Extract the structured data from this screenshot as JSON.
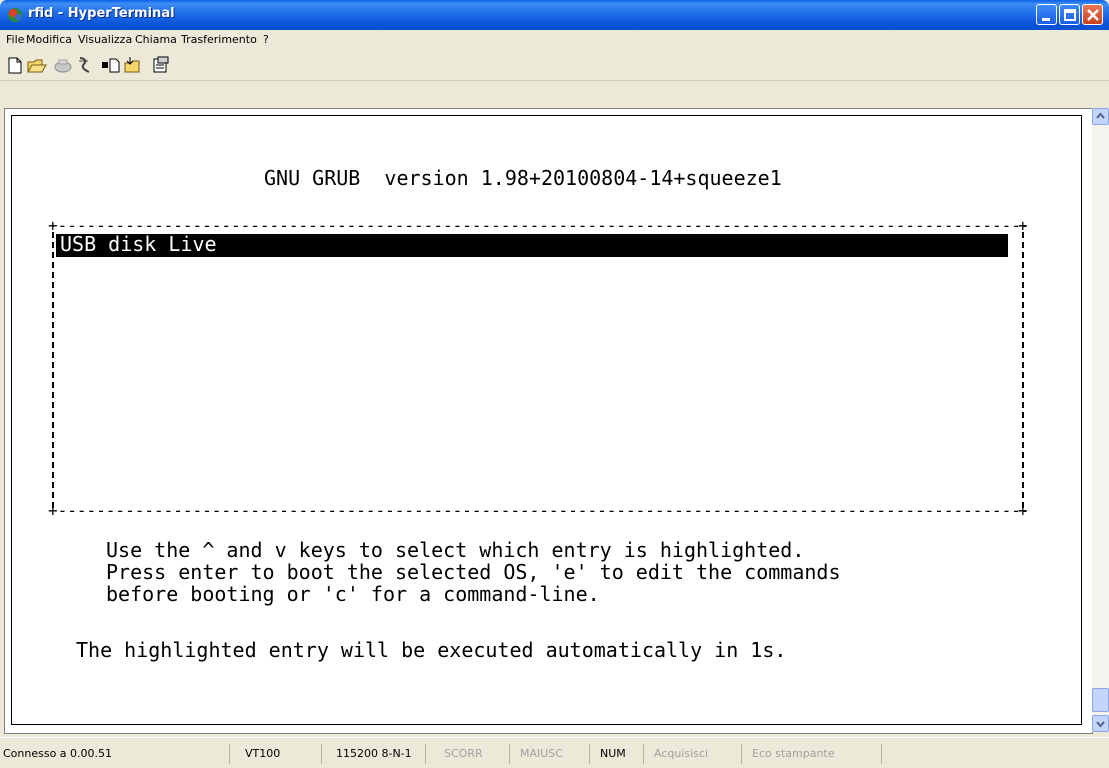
{
  "window": {
    "title": "rfid - HyperTerminal",
    "accent": "#0a5fe6"
  },
  "menu": [
    "File",
    "Modifica",
    "Visualizza",
    "Chiama",
    "Trasferimento",
    "?"
  ],
  "toolbar": {
    "icons": [
      "new-icon",
      "open-icon",
      "disconnect-icon",
      "call-icon",
      "send-icon",
      "receive-icon",
      "properties-icon"
    ]
  },
  "terminal": {
    "header": "GNU GRUB  version 1.98+20100804-14+squeeze1",
    "selected_entry": "USB disk Live",
    "help_line1": "Use the ^ and v keys to select which entry is highlighted.",
    "help_line2": "Press enter to boot the selected OS, 'e' to edit the commands",
    "help_line3": "before booting or 'c' for a command-line.",
    "countdown": "The highlighted entry will be executed automatically in 1s."
  },
  "status": {
    "connected": "Connesso a 0.00.51",
    "emulation": "VT100",
    "settings": "115200 8-N-1",
    "scroll": "SCORR",
    "caps": "MAIUSC",
    "num": "NUM",
    "capture": "Acquisisci",
    "print_echo": "Eco stampante"
  }
}
